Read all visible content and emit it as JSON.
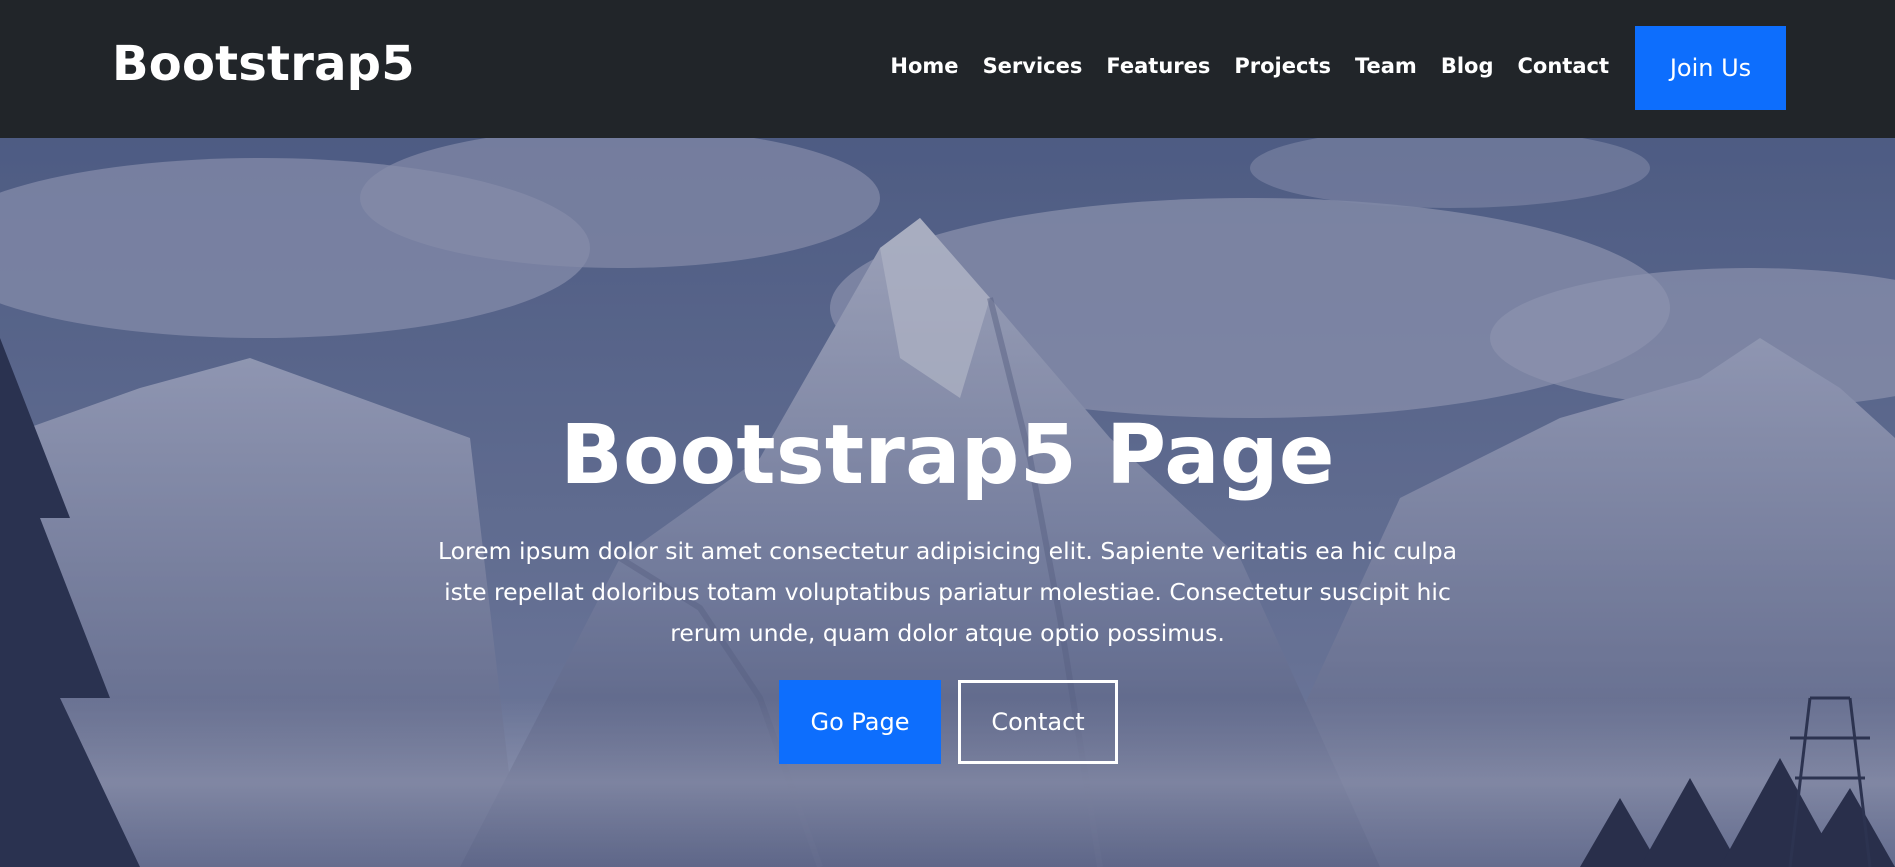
{
  "navbar": {
    "brand": "Bootstrap5",
    "links": [
      "Home",
      "Services",
      "Features",
      "Projects",
      "Team",
      "Blog",
      "Contact"
    ],
    "cta_label": "Join Us"
  },
  "hero": {
    "title": "Bootstrap5 Page",
    "description": "Lorem ipsum dolor sit amet consectetur adipisicing elit. Sapiente veritatis ea hic culpa iste repellat doloribus totam voluptatibus pariatur molestiae. Consectetur suscipit hic rerum unde, quam dolor atque optio possimus.",
    "primary_button": "Go Page",
    "secondary_button": "Contact"
  },
  "colors": {
    "navbar_bg": "#212529",
    "accent": "#0d6efd",
    "text": "#ffffff"
  }
}
